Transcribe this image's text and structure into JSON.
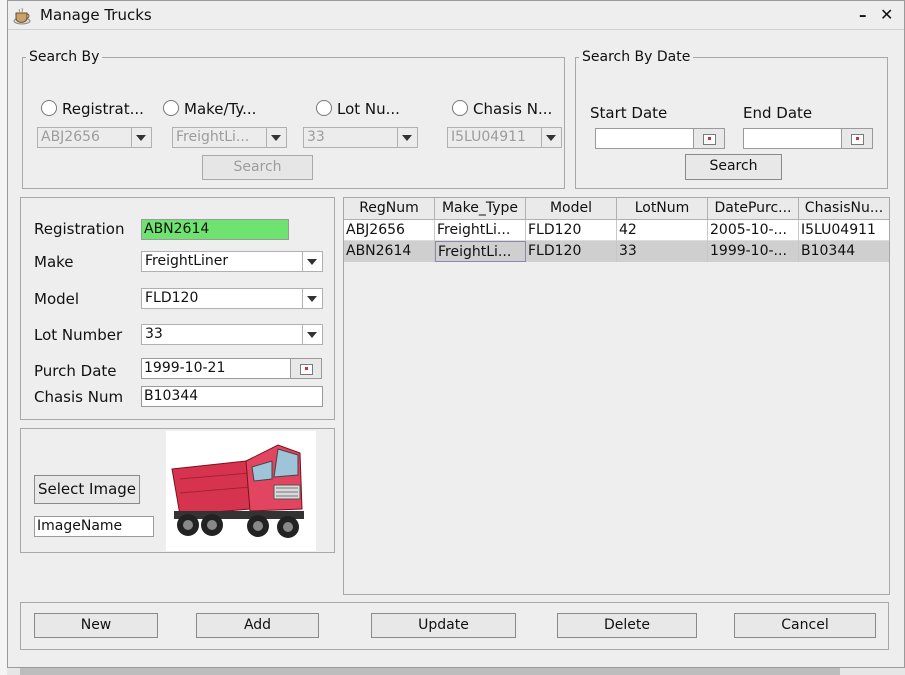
{
  "window": {
    "title": "Manage Trucks",
    "minimize": "–",
    "close": "✕"
  },
  "search_by": {
    "legend": "Search By",
    "options": [
      {
        "label": "Registrat...",
        "combo": "ABJ2656"
      },
      {
        "label": "Make/Ty...",
        "combo": "FreightLi..."
      },
      {
        "label": "Lot Nu...",
        "combo": "33"
      },
      {
        "label": "Chasis N...",
        "combo": "I5LU04911"
      }
    ],
    "search_button": "Search"
  },
  "search_by_date": {
    "legend": "Search By Date",
    "start_label": "Start Date",
    "end_label": "End Date",
    "start_value": "",
    "end_value": "",
    "search_button": "Search"
  },
  "form": {
    "registration_label": "Registration",
    "registration_value": "ABN2614",
    "make_label": "Make",
    "make_value": "FreightLiner",
    "model_label": "Model",
    "model_value": "FLD120",
    "lot_label": "Lot Number",
    "lot_value": "33",
    "purch_label": "Purch Date",
    "purch_value": "1999-10-21",
    "chasis_label": "Chasis Num",
    "chasis_value": "B10344",
    "highlight_color": "#6fe36f"
  },
  "image_panel": {
    "select_button": "Select Image",
    "image_name": "ImageName",
    "image_icon": "dump-truck-photo"
  },
  "table": {
    "columns": [
      "RegNum",
      "Make_Type",
      "Model",
      "LotNum",
      "DatePurc...",
      "ChasisNu..."
    ],
    "rows": [
      [
        "ABJ2656",
        "FreightLi...",
        "FLD120",
        "42",
        "2005-10-...",
        "I5LU04911"
      ],
      [
        "ABN2614",
        "FreightLi...",
        "FLD120",
        "33",
        "1999-10-...",
        "B10344"
      ]
    ],
    "selected_row": 1
  },
  "actions": {
    "new": "New",
    "add": "Add",
    "update": "Update",
    "delete": "Delete",
    "cancel": "Cancel"
  }
}
